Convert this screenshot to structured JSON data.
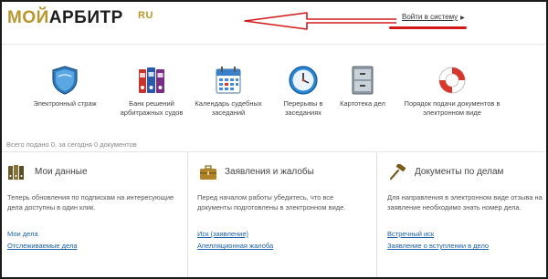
{
  "header": {
    "logo_part1": "МОЙ",
    "logo_part2": "АРБИТР",
    "logo_suffix": "RU",
    "login_link": "Войти в систему",
    "login_caret_icon": "caret-right-icon",
    "annotation_color": "#d21818"
  },
  "services": [
    {
      "label": "Электронный страж",
      "icon": "shield-icon"
    },
    {
      "label": "Банк решений арбитражных судов",
      "icon": "binders-icon"
    },
    {
      "label": "Календарь судебных заседаний",
      "icon": "calendar-icon"
    },
    {
      "label": "Перерывы в заседаниях",
      "icon": "clock-icon"
    },
    {
      "label": "Картотека дел",
      "icon": "file-cabinet-icon"
    },
    {
      "label": "Порядок подачи документов в электронном виде",
      "icon": "lifebuoy-icon"
    }
  ],
  "stats": "Всего подано 0, за сегодня 0 документов",
  "columns": [
    {
      "title": "Мои данные",
      "icon": "binders-small-icon",
      "description": "Теперь обновления по подпискам на интересующие дела доступны в один клик.",
      "links": [
        "Мои дела",
        "Отслеживаемые дела"
      ]
    },
    {
      "title": "Заявления и жалобы",
      "icon": "briefcase-icon",
      "description": "Перед началом работы убедитесь, что все документы подготовлены в электронном виде.",
      "links": [
        "Иск (заявление)",
        "Апелляционная жалоба"
      ]
    },
    {
      "title": "Документы по делам",
      "icon": "gavel-icon",
      "description": "Для направления в электронном виде отзыва на заявление необходимо знать номер дела.",
      "links": [
        "Встречный иск",
        "Заявление о вступлении в дело"
      ]
    }
  ],
  "colors": {
    "gold": "#b8972e",
    "link": "#1a5fa8",
    "text": "#333333"
  }
}
